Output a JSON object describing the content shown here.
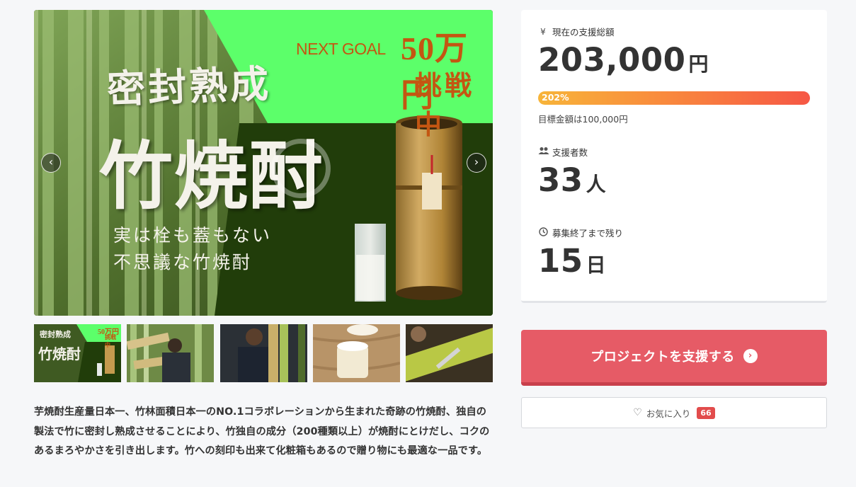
{
  "hero": {
    "next_goal_label": "NEXT GOAL",
    "next_goal_amount": "50万円",
    "challenge_label": "挑戦中",
    "headline_small": "密封熟成",
    "headline_large": "竹焼酎",
    "tagline_line1": "実は栓も蓋もない",
    "tagline_line2": "不思議な竹焼酎",
    "prev_arrow": "‹",
    "next_arrow": "›"
  },
  "thumbnails": [
    {
      "name": "thumb-main-visual"
    },
    {
      "name": "thumb-bamboo-forest"
    },
    {
      "name": "thumb-craftsman"
    },
    {
      "name": "thumb-pouring"
    },
    {
      "name": "thumb-engraving"
    }
  ],
  "description": "芋焼酎生産量日本一、竹林面積日本一のNO.1コラボレーションから生まれた奇跡の竹焼酎、独自の製法で竹に密封し熟成させることにより、竹独自の成分（200種類以上）が焼酎にとけだし、コクのあるまろやかさを引き出します。竹への刻印も出来て化粧箱もあるので贈り物にも最適な一品です。",
  "stats": {
    "total_label": "現在の支援総額",
    "total_value": "203,000",
    "total_unit": "円",
    "progress_text": "202%",
    "progress_percent": 202,
    "target_text": "目標金額は100,000円",
    "supporters_label": "支援者数",
    "supporters_value": "33",
    "supporters_unit": "人",
    "remaining_label": "募集終了まで残り",
    "remaining_value": "15",
    "remaining_unit": "日"
  },
  "actions": {
    "support_label": "プロジェクトを支援する",
    "favorite_label": "お気に入り",
    "favorite_count": "66"
  },
  "colors": {
    "accent_button": "#e65b66",
    "progress_start": "#f7b439",
    "progress_end": "#f65745",
    "goal_text": "#c45612"
  }
}
